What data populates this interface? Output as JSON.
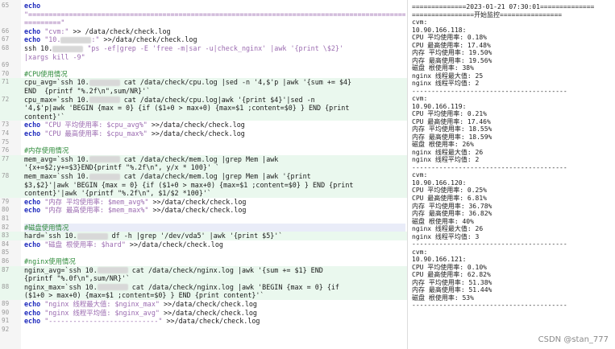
{
  "editor": {
    "lines": [
      {
        "num": "65",
        "hl": "",
        "parts": [
          [
            "kw",
            "echo"
          ]
        ]
      },
      {
        "num": "",
        "hl": "",
        "parts": [
          [
            "str",
            "\"=============================================================================================="
          ]
        ]
      },
      {
        "num": "",
        "hl": "",
        "parts": [
          [
            "str",
            "=========\""
          ]
        ]
      },
      {
        "num": "66",
        "hl": "",
        "parts": [
          [
            "kw",
            "echo"
          ],
          [
            "str",
            " \"cvm:\""
          ],
          [
            "plain",
            " >> /data/check/check.log"
          ]
        ]
      },
      {
        "num": "67",
        "hl": "",
        "parts": [
          [
            "kw",
            "echo"
          ],
          [
            "str",
            " \"10."
          ],
          [
            "blur",
            ""
          ],
          [
            "str",
            ":\""
          ],
          [
            "plain",
            " >>/data/check/check.log"
          ]
        ]
      },
      {
        "num": "68",
        "hl": "",
        "parts": [
          [
            "plain",
            "ssh 10."
          ],
          [
            "blur",
            ""
          ],
          [
            "str",
            " \"ps -ef|grep -E 'free -m|sar -u|check_nginx' |awk '{print \\$2}'"
          ]
        ]
      },
      {
        "num": "",
        "hl": "",
        "parts": [
          [
            "str",
            "|xargs kill -9\""
          ]
        ]
      },
      {
        "num": "69",
        "hl": "",
        "parts": []
      },
      {
        "num": "70",
        "hl": "",
        "parts": [
          [
            "cmt",
            "#CPU使用情况"
          ]
        ]
      },
      {
        "num": "71",
        "hl": "green",
        "parts": [
          [
            "plain",
            "cpu_avg=`ssh 10."
          ],
          [
            "blur",
            ""
          ],
          [
            "plain",
            " cat /data/check/cpu.log |sed -n '4,$'p |awk '{sum += $4}"
          ]
        ]
      },
      {
        "num": "",
        "hl": "green",
        "parts": [
          [
            "plain",
            "END  {printf \"%.2f\\n\",sum/NR}'`"
          ]
        ]
      },
      {
        "num": "72",
        "hl": "green",
        "parts": [
          [
            "plain",
            "cpu_max=`ssh 10."
          ],
          [
            "blur",
            ""
          ],
          [
            "plain",
            " cat /data/check/cpu.log|awk '{print $4}'|sed -n"
          ]
        ]
      },
      {
        "num": "",
        "hl": "green",
        "parts": [
          [
            "plain",
            "'4,$'p|awk 'BEGIN {max = 0} {if ($1+0 > max+0) {max=$1 ;content=$0} } END {print"
          ]
        ]
      },
      {
        "num": "",
        "hl": "green",
        "parts": [
          [
            "plain",
            "content}'`"
          ]
        ]
      },
      {
        "num": "73",
        "hl": "",
        "parts": [
          [
            "kw",
            "echo"
          ],
          [
            "str",
            " \"CPU 平均使用率: $cpu_avg%\""
          ],
          [
            "plain",
            " >>/data/check/check.log"
          ]
        ]
      },
      {
        "num": "74",
        "hl": "",
        "parts": [
          [
            "kw",
            "echo"
          ],
          [
            "str",
            " \"CPU 最高使用率: $cpu_max%\""
          ],
          [
            "plain",
            " >>/data/check/check.log"
          ]
        ]
      },
      {
        "num": "75",
        "hl": "",
        "parts": []
      },
      {
        "num": "76",
        "hl": "",
        "parts": [
          [
            "cmt",
            "#内存使用情况"
          ]
        ]
      },
      {
        "num": "77",
        "hl": "green",
        "parts": [
          [
            "plain",
            "mem_avg=`ssh 10."
          ],
          [
            "blur",
            ""
          ],
          [
            "plain",
            " cat /data/check/mem.log |grep Mem |awk"
          ]
        ]
      },
      {
        "num": "",
        "hl": "green",
        "parts": [
          [
            "plain",
            "'{x+=$2;y+=$3}END{printf \"%.2f\\n\", y/x * 100}' `"
          ]
        ]
      },
      {
        "num": "78",
        "hl": "green",
        "parts": [
          [
            "plain",
            "mem_max=`ssh 10."
          ],
          [
            "blur",
            ""
          ],
          [
            "plain",
            " cat /data/check/mem.log |grep Mem |awk '{print"
          ]
        ]
      },
      {
        "num": "",
        "hl": "green",
        "parts": [
          [
            "plain",
            "$3,$2}'|awk 'BEGIN {max = 0} {if ($1+0 > max+0) {max=$1 ;content=$0} } END {print"
          ]
        ]
      },
      {
        "num": "",
        "hl": "green",
        "parts": [
          [
            "plain",
            "content}'|awk '{printf \"%.2f\\n\", $1/$2 *100}'`"
          ]
        ]
      },
      {
        "num": "79",
        "hl": "",
        "parts": [
          [
            "kw",
            "echo"
          ],
          [
            "str",
            " \"内存 平均使用率: $mem_avg%\""
          ],
          [
            "plain",
            " >>/data/check/check.log"
          ]
        ]
      },
      {
        "num": "80",
        "hl": "",
        "parts": [
          [
            "kw",
            "echo"
          ],
          [
            "str",
            " \"内存 最高使用率: $mem_max%\""
          ],
          [
            "plain",
            " >>/data/check/check.log"
          ]
        ]
      },
      {
        "num": "81",
        "hl": "",
        "parts": []
      },
      {
        "num": "82",
        "hl": "blue",
        "parts": [
          [
            "cmt",
            "#磁盘使用情况"
          ]
        ]
      },
      {
        "num": "83",
        "hl": "green",
        "parts": [
          [
            "plain",
            "hard=`ssh 10."
          ],
          [
            "blur",
            ""
          ],
          [
            "plain",
            " df -h |grep '/dev/vda5' |awk '{print $5}'`"
          ]
        ]
      },
      {
        "num": "84",
        "hl": "",
        "parts": [
          [
            "kw",
            "echo"
          ],
          [
            "str",
            " \"磁盘 根使用率: $hard\""
          ],
          [
            "plain",
            " >>/data/check/check.log"
          ]
        ]
      },
      {
        "num": "85",
        "hl": "",
        "parts": []
      },
      {
        "num": "86",
        "hl": "",
        "parts": [
          [
            "cmt",
            "#nginx使用情况"
          ]
        ]
      },
      {
        "num": "87",
        "hl": "green",
        "parts": [
          [
            "plain",
            "nginx_avg=`ssh 10."
          ],
          [
            "blur",
            ""
          ],
          [
            "plain",
            " cat /data/check/nginx.log |awk '{sum += $1} END"
          ]
        ]
      },
      {
        "num": "",
        "hl": "green",
        "parts": [
          [
            "plain",
            "{printf \"%.0f\\n\",sum/NR}'`"
          ]
        ]
      },
      {
        "num": "88",
        "hl": "green",
        "parts": [
          [
            "plain",
            "nginx_max=`ssh 10."
          ],
          [
            "blur",
            ""
          ],
          [
            "plain",
            " cat /data/check/nginx.log |awk 'BEGIN {max = 0} {if"
          ]
        ]
      },
      {
        "num": "",
        "hl": "green",
        "parts": [
          [
            "plain",
            "($1+0 > max+0) {max=$1 ;content=$0} } END {print content}'`"
          ]
        ]
      },
      {
        "num": "89",
        "hl": "",
        "parts": [
          [
            "kw",
            "echo"
          ],
          [
            "str",
            " \"nginx 线程最大值: $nginx_max\""
          ],
          [
            "plain",
            " >>/data/check/check.log"
          ]
        ]
      },
      {
        "num": "90",
        "hl": "",
        "parts": [
          [
            "kw",
            "echo"
          ],
          [
            "str",
            " \"nginx 线程平均值: $nginx_avg\""
          ],
          [
            "plain",
            " >>/data/check/check.log"
          ]
        ]
      },
      {
        "num": "91",
        "hl": "",
        "parts": [
          [
            "kw",
            "echo"
          ],
          [
            "str",
            " \"---------------------------\""
          ],
          [
            "plain",
            " >>/data/check/check.log"
          ]
        ]
      },
      {
        "num": "92",
        "hl": "",
        "parts": []
      }
    ]
  },
  "output": {
    "lines": [
      "==============2023-01-21 07:30:01==============",
      "================开始监控================",
      "cvm:",
      "10.90.166.118:",
      "CPU 平均使用率: 0.18%",
      "CPU 最高使用率: 17.48%",
      "内存 平均使用率: 19.50%",
      "内存 最高使用率: 19.56%",
      "磁盘 根使用率: 38%",
      "nginx 线程最大值: 25",
      "nginx 线程平均值: 2",
      "----------------------------------------",
      "cvm:",
      "10.90.166.119:",
      "CPU 平均使用率: 0.21%",
      "CPU 最高使用率: 17.46%",
      "内存 平均使用率: 18.55%",
      "内存 最高使用率: 18.59%",
      "磁盘 根使用率: 26%",
      "nginx 线程最大值: 26",
      "nginx 线程平均值: 2",
      "----------------------------------------",
      "cvm:",
      "10.90.166.120:",
      "CPU 平均使用率: 0.25%",
      "CPU 最高使用率: 6.81%",
      "内存 平均使用率: 36.78%",
      "内存 最高使用率: 36.82%",
      "磁盘 根使用率: 40%",
      "nginx 线程最大值: 26",
      "nginx 线程平均值: 3",
      "----------------------------------------",
      "cvm:",
      "10.90.166.121:",
      "CPU 平均使用率: 0.10%",
      "CPU 最高使用率: 62.82%",
      "内存 平均使用率: 51.38%",
      "内存 最高使用率: 51.44%",
      "磁盘 根使用率: 53%",
      "----------------------------------------"
    ]
  },
  "watermark": "CSDN @stan_777"
}
